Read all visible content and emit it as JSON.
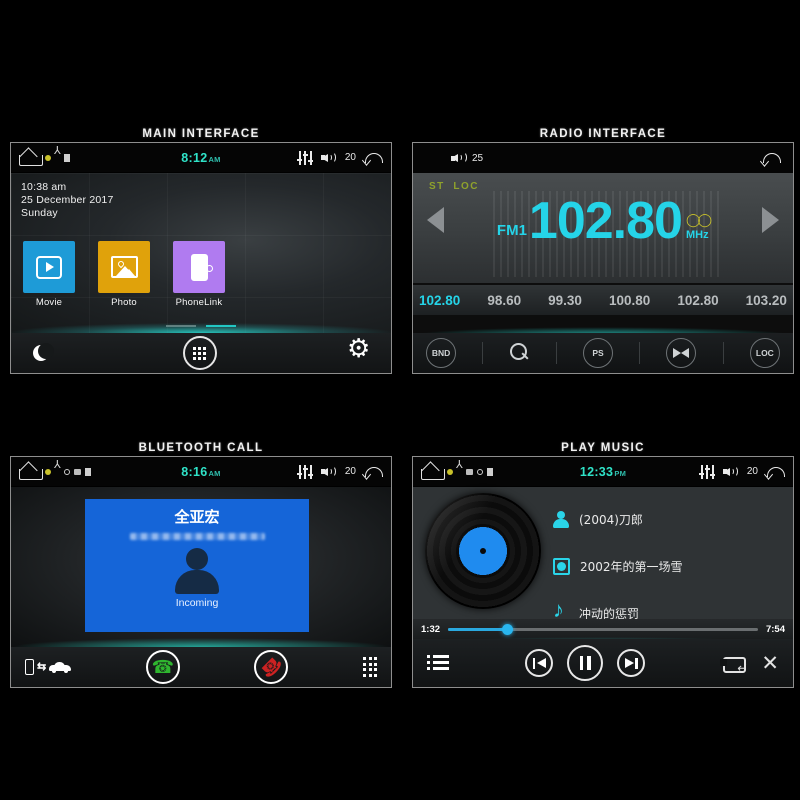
{
  "panels": {
    "main": {
      "title": "MAIN INTERFACE"
    },
    "radio": {
      "title": "RADIO INTERFACE"
    },
    "bluetooth": {
      "title": "BLUETOOTH CALL"
    },
    "music": {
      "title": "PLAY MUSIC"
    }
  },
  "main_interface": {
    "statusbar": {
      "home_icon": "home-icon",
      "clock": "8:12",
      "clock_ampm": "AM",
      "eq_icon": "equalizer-icon",
      "volume_icon": "speaker-icon",
      "volume": "20",
      "back_icon": "back-arrow-icon"
    },
    "date": {
      "time": "10:38 am",
      "date": "25 December 2017",
      "weekday": "Sunday"
    },
    "apps": [
      {
        "label": "Movie",
        "icon": "movie-icon",
        "color": "#1e9bd7"
      },
      {
        "label": "Photo",
        "icon": "photo-icon",
        "color": "#e0a20b"
      },
      {
        "label": "PhoneLink",
        "icon": "phonelink-icon",
        "color": "#b07bf0"
      }
    ],
    "pager": {
      "pages": 2,
      "active": 2
    },
    "dock": [
      {
        "name": "night-mode-button",
        "icon": "moon-icon"
      },
      {
        "name": "all-apps-button",
        "icon": "grid-dots-icon"
      },
      {
        "name": "settings-button",
        "icon": "gear-icon"
      }
    ]
  },
  "radio_interface": {
    "statusbar": {
      "volume_icon": "speaker-icon",
      "volume": "25",
      "back_icon": "back-arrow-icon"
    },
    "indicators": {
      "st": "ST",
      "loc": "LOC"
    },
    "band": "FM1",
    "frequency": "102.80",
    "unit": "MHz",
    "stereo_icon": "stereo-icon",
    "prev_arrow": "seek-down-icon",
    "next_arrow": "seek-up-icon",
    "current_preset": "102.80",
    "presets": [
      "98.60",
      "99.30",
      "100.80",
      "102.80",
      "103.20"
    ],
    "dock": [
      {
        "label": "BND",
        "name": "band-button"
      },
      {
        "label": "",
        "name": "search-button",
        "icon": "search-icon"
      },
      {
        "label": "PS",
        "name": "preset-scan-button"
      },
      {
        "label": "",
        "name": "af-button",
        "icon": "af-bowtie-icon"
      },
      {
        "label": "LOC",
        "name": "loc-button"
      }
    ]
  },
  "bluetooth_call": {
    "statusbar": {
      "clock": "8:16",
      "clock_ampm": "AM",
      "volume": "20",
      "eq_icon": "equalizer-icon",
      "volume_icon": "speaker-icon",
      "back_icon": "back-arrow-icon"
    },
    "caller_name": "全亚宏",
    "caller_number_masked": "",
    "call_state": "Incoming",
    "avatar_icon": "contact-avatar-icon",
    "dock": [
      {
        "name": "audio-transfer-button",
        "icon": "phone-to-car-icon"
      },
      {
        "name": "answer-call-button",
        "icon": "green-phone-icon"
      },
      {
        "name": "end-call-button",
        "icon": "red-phone-icon"
      },
      {
        "name": "keypad-button",
        "icon": "keypad-dots-icon"
      }
    ]
  },
  "play_music": {
    "statusbar": {
      "clock": "12:33",
      "clock_ampm": "PM",
      "volume": "20",
      "eq_icon": "equalizer-icon",
      "volume_icon": "speaker-icon",
      "back_icon": "back-arrow-icon"
    },
    "album_art_icon": "vinyl-record-icon",
    "metadata": [
      {
        "icon": "artist-icon",
        "text": "(2004)刀郎"
      },
      {
        "icon": "album-icon",
        "text": "2002年的第一场雪"
      },
      {
        "icon": "music-note-icon",
        "text": "冲动的惩罚"
      }
    ],
    "elapsed": "1:32",
    "duration": "7:54",
    "progress_percent": 19,
    "dock": [
      {
        "name": "playlist-button",
        "icon": "list-icon"
      },
      {
        "name": "previous-track-button",
        "icon": "previous-icon"
      },
      {
        "name": "play-pause-button",
        "icon": "pause-icon"
      },
      {
        "name": "next-track-button",
        "icon": "next-icon"
      },
      {
        "name": "repeat-button",
        "icon": "repeat-icon"
      },
      {
        "name": "shuffle-button",
        "icon": "shuffle-icon"
      }
    ]
  },
  "colors": {
    "accent_cyan": "#25d4e8",
    "clock_green": "#2fe3c8",
    "stereo_yellow": "#c9c22a",
    "call_card_blue": "#1565d8",
    "answer_green": "#2fb62f",
    "end_red": "#cc2222"
  }
}
